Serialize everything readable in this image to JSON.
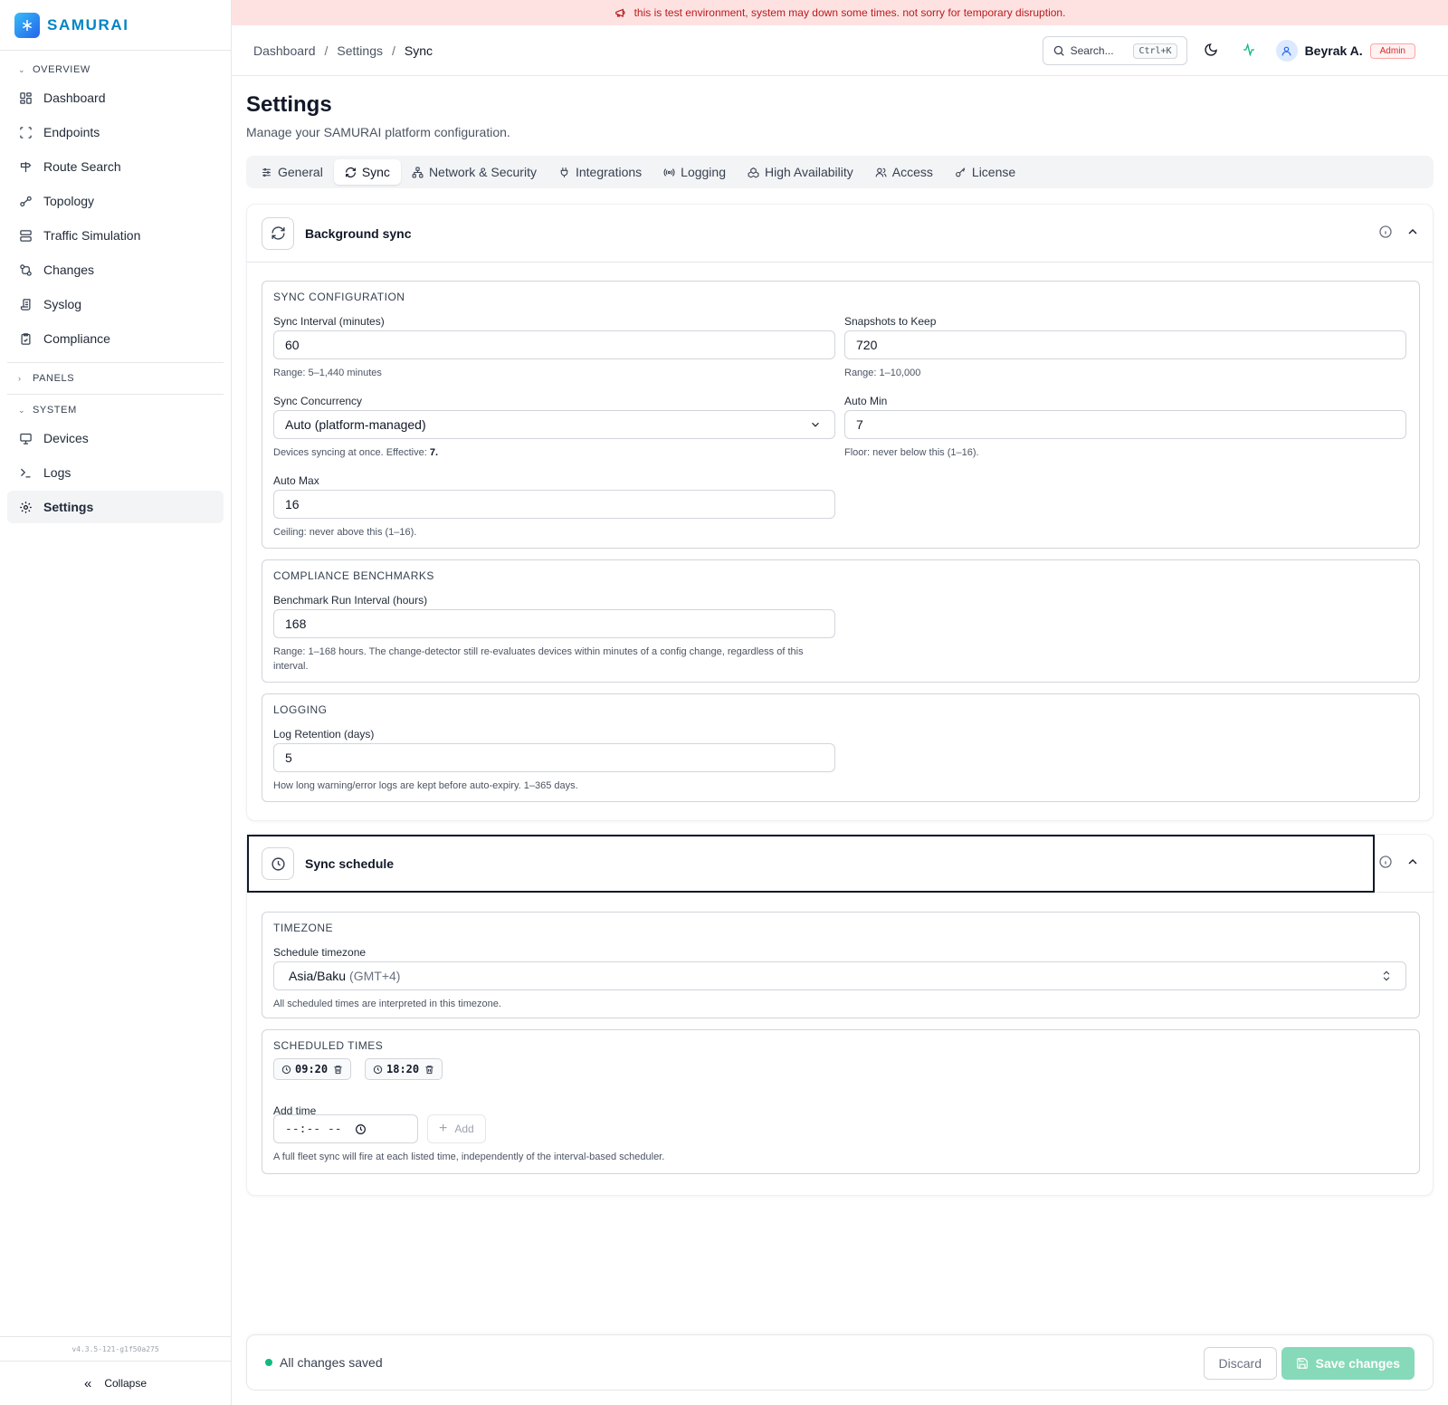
{
  "app": {
    "name": "SAMURAI",
    "version": "v4.3.5-121-g1f50a275",
    "collapse_label": "Collapse"
  },
  "banner": {
    "text": "this is test environment, system may down some times. not sorry for temporary disruption."
  },
  "sidebar": {
    "sections": {
      "overview": "OVERVIEW",
      "panels": "PANELS",
      "system": "SYSTEM"
    },
    "overview_items": [
      {
        "label": "Dashboard",
        "icon": "grid-icon"
      },
      {
        "label": "Endpoints",
        "icon": "scan-icon"
      },
      {
        "label": "Route Search",
        "icon": "signpost-icon"
      },
      {
        "label": "Topology",
        "icon": "workflow-icon"
      },
      {
        "label": "Traffic Simulation",
        "icon": "traffic-icon"
      },
      {
        "label": "Changes",
        "icon": "git-compare-icon"
      },
      {
        "label": "Syslog",
        "icon": "scroll-icon"
      },
      {
        "label": "Compliance",
        "icon": "clipboard-check-icon"
      }
    ],
    "system_items": [
      {
        "label": "Devices",
        "icon": "monitor-icon"
      },
      {
        "label": "Logs",
        "icon": "terminal-icon"
      },
      {
        "label": "Settings",
        "icon": "gear-icon",
        "active": true
      }
    ]
  },
  "header": {
    "breadcrumb": [
      "Dashboard",
      "Settings",
      "Sync"
    ],
    "search_placeholder": "Search...",
    "search_shortcut": "Ctrl+K",
    "user_name": "Beyrak A.",
    "user_role": "Admin"
  },
  "page": {
    "title": "Settings",
    "subtitle": "Manage your SAMURAI platform configuration."
  },
  "tabs": [
    {
      "label": "General",
      "icon": "sliders-icon"
    },
    {
      "label": "Sync",
      "icon": "refresh-icon",
      "active": true
    },
    {
      "label": "Network & Security",
      "icon": "network-icon"
    },
    {
      "label": "Integrations",
      "icon": "plug-icon"
    },
    {
      "label": "Logging",
      "icon": "radio-icon"
    },
    {
      "label": "High Availability",
      "icon": "boxes-icon"
    },
    {
      "label": "Access",
      "icon": "users-icon"
    },
    {
      "label": "License",
      "icon": "key-icon"
    }
  ],
  "background_sync": {
    "title": "Background sync",
    "sync_configuration": {
      "title": "SYNC CONFIGURATION",
      "sync_interval": {
        "label": "Sync Interval (minutes)",
        "value": "60",
        "hint": "Range: 5–1,440 minutes"
      },
      "snapshots": {
        "label": "Snapshots to Keep",
        "value": "720",
        "hint": "Range: 1–10,000"
      },
      "concurrency": {
        "label": "Sync Concurrency",
        "value": "Auto (platform-managed)",
        "hint_prefix": "Devices syncing at once. Effective: ",
        "hint_value": "7."
      },
      "auto_min": {
        "label": "Auto Min",
        "value": "7",
        "hint": "Floor: never below this (1–16)."
      },
      "auto_max": {
        "label": "Auto Max",
        "value": "16",
        "hint": "Ceiling: never above this (1–16)."
      }
    },
    "compliance": {
      "title": "COMPLIANCE BENCHMARKS",
      "label": "Benchmark Run Interval (hours)",
      "value": "168",
      "hint": "Range: 1–168 hours. The change-detector still re-evaluates devices within minutes of a config change, regardless of this interval."
    },
    "logging": {
      "title": "LOGGING",
      "label": "Log Retention (days)",
      "value": "5",
      "hint": "How long warning/error logs are kept before auto-expiry. 1–365 days."
    }
  },
  "sync_schedule": {
    "title": "Sync schedule",
    "timezone": {
      "title": "TIMEZONE",
      "label": "Schedule timezone",
      "value": "Asia/Baku",
      "offset": "(GMT+4)",
      "hint": "All scheduled times are interpreted in this timezone."
    },
    "scheduled_times": {
      "title": "SCHEDULED TIMES",
      "times": [
        "09:20",
        "18:20"
      ],
      "add_label": "Add time",
      "time_placeholder": "--:-- --",
      "add_button": "Add",
      "hint": "A full fleet sync will fire at each listed time, independently of the interval-based scheduler."
    }
  },
  "footer": {
    "status": "All changes saved",
    "discard": "Discard",
    "save": "Save changes"
  },
  "colors": {
    "brand": "#0284c7",
    "status_ok": "#10b981",
    "save_button": "#86d9b9",
    "banner_bg": "#fee2e2",
    "banner_text": "#b91c1c",
    "admin_badge": "#dc2626"
  }
}
